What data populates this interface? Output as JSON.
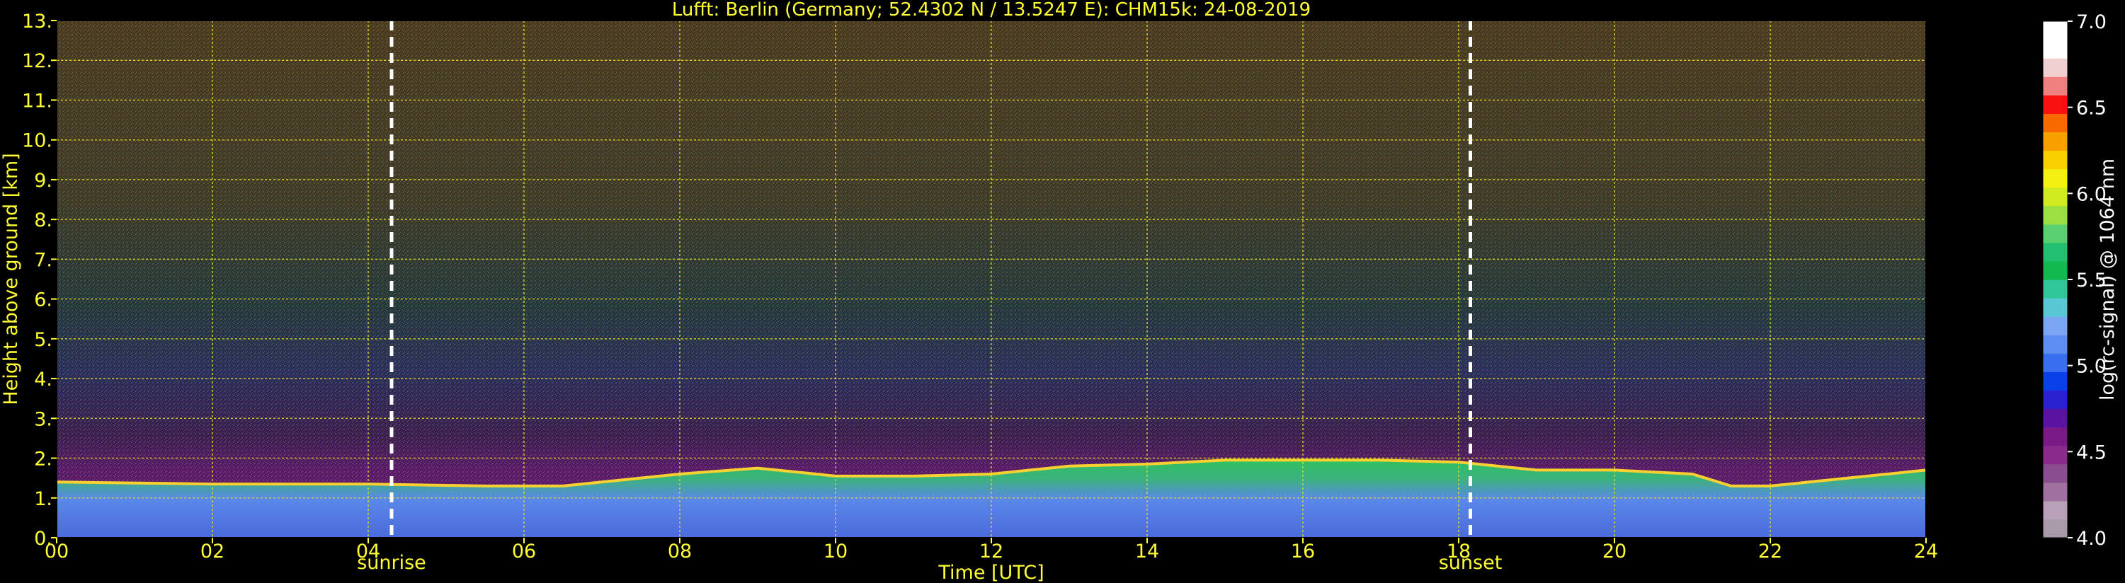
{
  "chart_data": {
    "type": "heatmap",
    "title": "Lufft: Berlin (Germany; 52.4302 N / 13.5247 E):    CHM15k: 24-08-2019",
    "xlabel": "Time [UTC]",
    "ylabel": "Height above ground [km]",
    "xlim": [
      0,
      24
    ],
    "ylim": [
      0,
      13
    ],
    "x_ticks": [
      {
        "value": 0,
        "label": "00"
      },
      {
        "value": 2,
        "label": "02"
      },
      {
        "value": 4,
        "label": "04"
      },
      {
        "value": 6,
        "label": "06"
      },
      {
        "value": 8,
        "label": "08"
      },
      {
        "value": 10,
        "label": "10"
      },
      {
        "value": 12,
        "label": "12"
      },
      {
        "value": 14,
        "label": "14"
      },
      {
        "value": 16,
        "label": "16"
      },
      {
        "value": 18,
        "label": "18"
      },
      {
        "value": 20,
        "label": "20"
      },
      {
        "value": 22,
        "label": "22"
      },
      {
        "value": 24,
        "label": "24"
      }
    ],
    "y_ticks": [
      {
        "value": 0,
        "label": "0."
      },
      {
        "value": 1,
        "label": "1."
      },
      {
        "value": 2,
        "label": "2."
      },
      {
        "value": 3,
        "label": "3."
      },
      {
        "value": 4,
        "label": "4."
      },
      {
        "value": 5,
        "label": "5."
      },
      {
        "value": 6,
        "label": "6."
      },
      {
        "value": 7,
        "label": "7."
      },
      {
        "value": 8,
        "label": "8."
      },
      {
        "value": 9,
        "label": "9."
      },
      {
        "value": 10,
        "label": "10."
      },
      {
        "value": 11,
        "label": "11."
      },
      {
        "value": 12,
        "label": "12."
      },
      {
        "value": 13,
        "label": "13."
      }
    ],
    "grid": true,
    "markers": [
      {
        "name": "sunrise",
        "x": 4.3
      },
      {
        "name": "sunset",
        "x": 18.15
      }
    ],
    "boundary_layer": {
      "description_units": "km",
      "x": [
        0,
        2,
        4,
        5.5,
        6.5,
        8,
        9,
        10,
        11,
        12,
        13,
        14,
        15,
        16,
        17,
        18,
        19,
        20,
        21,
        21.5,
        22,
        23,
        24
      ],
      "top": [
        1.4,
        1.35,
        1.35,
        1.3,
        1.3,
        1.6,
        1.75,
        1.55,
        1.55,
        1.6,
        1.8,
        1.85,
        1.95,
        1.95,
        1.95,
        1.9,
        1.7,
        1.7,
        1.6,
        1.3,
        1.3,
        1.5,
        1.7
      ]
    },
    "colorbar": {
      "label": "log(rc-signal) @ 1064 nm",
      "range": [
        4.0,
        7.0
      ],
      "ticks": [
        {
          "value": 4.0,
          "label": "4.0"
        },
        {
          "value": 4.5,
          "label": "4.5"
        },
        {
          "value": 5.0,
          "label": "5.0"
        },
        {
          "value": 5.5,
          "label": "5.5"
        },
        {
          "value": 6.0,
          "label": "6.0"
        },
        {
          "value": 6.5,
          "label": "6.5"
        },
        {
          "value": 7.0,
          "label": "7.0"
        }
      ],
      "colors": [
        "#a89aa8",
        "#b8a0b8",
        "#a070a0",
        "#8a4e8e",
        "#8a2a8a",
        "#7a1a86",
        "#5a12a0",
        "#2a20d0",
        "#0a40e8",
        "#3a6ef0",
        "#5e8ef4",
        "#7aa6f4",
        "#5ac8d4",
        "#2ec89a",
        "#12b850",
        "#20c070",
        "#5ad070",
        "#9ae040",
        "#d0ec20",
        "#f4f010",
        "#f8d000",
        "#f8a000",
        "#f86a00",
        "#f81010",
        "#f08080",
        "#f0d0d0",
        "#ffffff",
        "#ffffff"
      ]
    }
  }
}
